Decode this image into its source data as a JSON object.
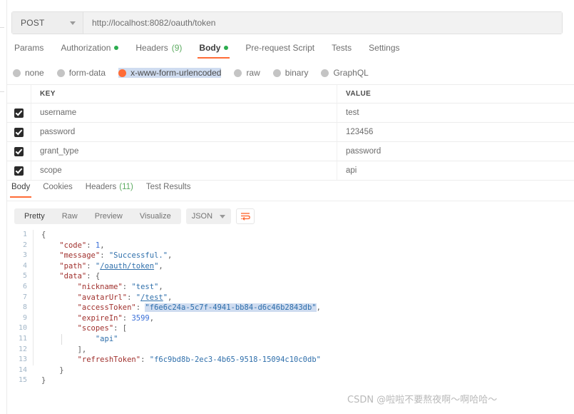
{
  "request": {
    "method": "POST",
    "url": "http://localhost:8082/oauth/token",
    "tabs": [
      {
        "label": "Params",
        "dot": false,
        "count": "",
        "active": false
      },
      {
        "label": "Authorization",
        "dot": true,
        "count": "",
        "active": false
      },
      {
        "label": "Headers",
        "dot": false,
        "count": "(9)",
        "active": false
      },
      {
        "label": "Body",
        "dot": true,
        "count": "",
        "active": true
      },
      {
        "label": "Pre-request Script",
        "dot": false,
        "count": "",
        "active": false
      },
      {
        "label": "Tests",
        "dot": false,
        "count": "",
        "active": false
      },
      {
        "label": "Settings",
        "dot": false,
        "count": "",
        "active": false
      }
    ],
    "body_types": [
      {
        "label": "none",
        "selected": false
      },
      {
        "label": "form-data",
        "selected": false
      },
      {
        "label": "x-www-form-urlencoded",
        "selected": true
      },
      {
        "label": "raw",
        "selected": false
      },
      {
        "label": "binary",
        "selected": false
      },
      {
        "label": "GraphQL",
        "selected": false
      }
    ],
    "table": {
      "headers": {
        "key": "KEY",
        "value": "VALUE"
      },
      "rows": [
        {
          "checked": true,
          "key": "username",
          "value": "test"
        },
        {
          "checked": true,
          "key": "password",
          "value": "123456"
        },
        {
          "checked": true,
          "key": "grant_type",
          "value": "password"
        },
        {
          "checked": true,
          "key": "scope",
          "value": "api"
        }
      ]
    }
  },
  "response": {
    "tabs": [
      {
        "label": "Body",
        "count": "",
        "active": true
      },
      {
        "label": "Cookies",
        "count": "",
        "active": false
      },
      {
        "label": "Headers",
        "count": "(11)",
        "active": false
      },
      {
        "label": "Test Results",
        "count": "",
        "active": false
      }
    ],
    "viewer": {
      "modes": [
        {
          "label": "Pretty",
          "active": true
        },
        {
          "label": "Raw",
          "active": false
        },
        {
          "label": "Preview",
          "active": false
        },
        {
          "label": "Visualize",
          "active": false
        }
      ],
      "format": "JSON",
      "wrap_icon": "word-wrap-icon"
    },
    "code_lines": [
      {
        "n": "1",
        "segs": [
          {
            "t": "{",
            "c": "p"
          }
        ]
      },
      {
        "n": "2",
        "segs": [
          {
            "t": "    ",
            "c": "p"
          },
          {
            "t": "\"code\"",
            "c": "k"
          },
          {
            "t": ": ",
            "c": "p"
          },
          {
            "t": "1",
            "c": "n"
          },
          {
            "t": ",",
            "c": "p"
          }
        ]
      },
      {
        "n": "3",
        "segs": [
          {
            "t": "    ",
            "c": "p"
          },
          {
            "t": "\"message\"",
            "c": "k"
          },
          {
            "t": ": ",
            "c": "p"
          },
          {
            "t": "\"Successful.\"",
            "c": "s"
          },
          {
            "t": ",",
            "c": "p"
          }
        ]
      },
      {
        "n": "4",
        "segs": [
          {
            "t": "    ",
            "c": "p"
          },
          {
            "t": "\"path\"",
            "c": "k"
          },
          {
            "t": ": ",
            "c": "p"
          },
          {
            "t": "\"",
            "c": "s"
          },
          {
            "t": "/oauth/token",
            "c": "lnk"
          },
          {
            "t": "\"",
            "c": "s"
          },
          {
            "t": ",",
            "c": "p"
          }
        ]
      },
      {
        "n": "5",
        "segs": [
          {
            "t": "    ",
            "c": "p"
          },
          {
            "t": "\"data\"",
            "c": "k"
          },
          {
            "t": ": {",
            "c": "p"
          }
        ]
      },
      {
        "n": "6",
        "segs": [
          {
            "t": "        ",
            "c": "p"
          },
          {
            "t": "\"nickname\"",
            "c": "k"
          },
          {
            "t": ": ",
            "c": "p"
          },
          {
            "t": "\"test\"",
            "c": "s"
          },
          {
            "t": ",",
            "c": "p"
          }
        ]
      },
      {
        "n": "7",
        "segs": [
          {
            "t": "        ",
            "c": "p"
          },
          {
            "t": "\"avatarUrl\"",
            "c": "k"
          },
          {
            "t": ": ",
            "c": "p"
          },
          {
            "t": "\"",
            "c": "s"
          },
          {
            "t": "/test",
            "c": "lnk"
          },
          {
            "t": "\"",
            "c": "s"
          },
          {
            "t": ",",
            "c": "p"
          }
        ]
      },
      {
        "n": "8",
        "segs": [
          {
            "t": "        ",
            "c": "p"
          },
          {
            "t": "\"accessToken\"",
            "c": "k"
          },
          {
            "t": ": ",
            "c": "p"
          },
          {
            "t": "\"f6e6c24a-5c7f-4941-bb84-d6c46b2843db\"",
            "c": "s sel"
          },
          {
            "t": ",",
            "c": "p"
          }
        ]
      },
      {
        "n": "9",
        "segs": [
          {
            "t": "        ",
            "c": "p"
          },
          {
            "t": "\"expireIn\"",
            "c": "k"
          },
          {
            "t": ": ",
            "c": "p"
          },
          {
            "t": "3599",
            "c": "n"
          },
          {
            "t": ",",
            "c": "p"
          }
        ]
      },
      {
        "n": "10",
        "segs": [
          {
            "t": "        ",
            "c": "p"
          },
          {
            "t": "\"scopes\"",
            "c": "k"
          },
          {
            "t": ": [",
            "c": "p"
          }
        ]
      },
      {
        "n": "11",
        "segs": [
          {
            "t": "            ",
            "c": "p"
          },
          {
            "t": "\"api\"",
            "c": "s"
          }
        ]
      },
      {
        "n": "12",
        "segs": [
          {
            "t": "        ],",
            "c": "p"
          }
        ]
      },
      {
        "n": "13",
        "segs": [
          {
            "t": "        ",
            "c": "p"
          },
          {
            "t": "\"refreshToken\"",
            "c": "k"
          },
          {
            "t": ": ",
            "c": "p"
          },
          {
            "t": "\"f6c9bd8b-2ec3-4b65-9518-15094c10c0db\"",
            "c": "s"
          }
        ]
      },
      {
        "n": "14",
        "segs": [
          {
            "t": "    }",
            "c": "p"
          }
        ]
      },
      {
        "n": "15",
        "segs": [
          {
            "t": "}",
            "c": "p"
          }
        ]
      }
    ]
  },
  "watermark": "CSDN @啦啦不要熬夜啊～啊哈哈～",
  "colors": {
    "accent": "#ff6c37",
    "green": "#2bac4e",
    "json_key": "#a0302d",
    "json_string": "#2f6fab",
    "json_number": "#3a6fd8",
    "selection": "#cfdcf0"
  }
}
